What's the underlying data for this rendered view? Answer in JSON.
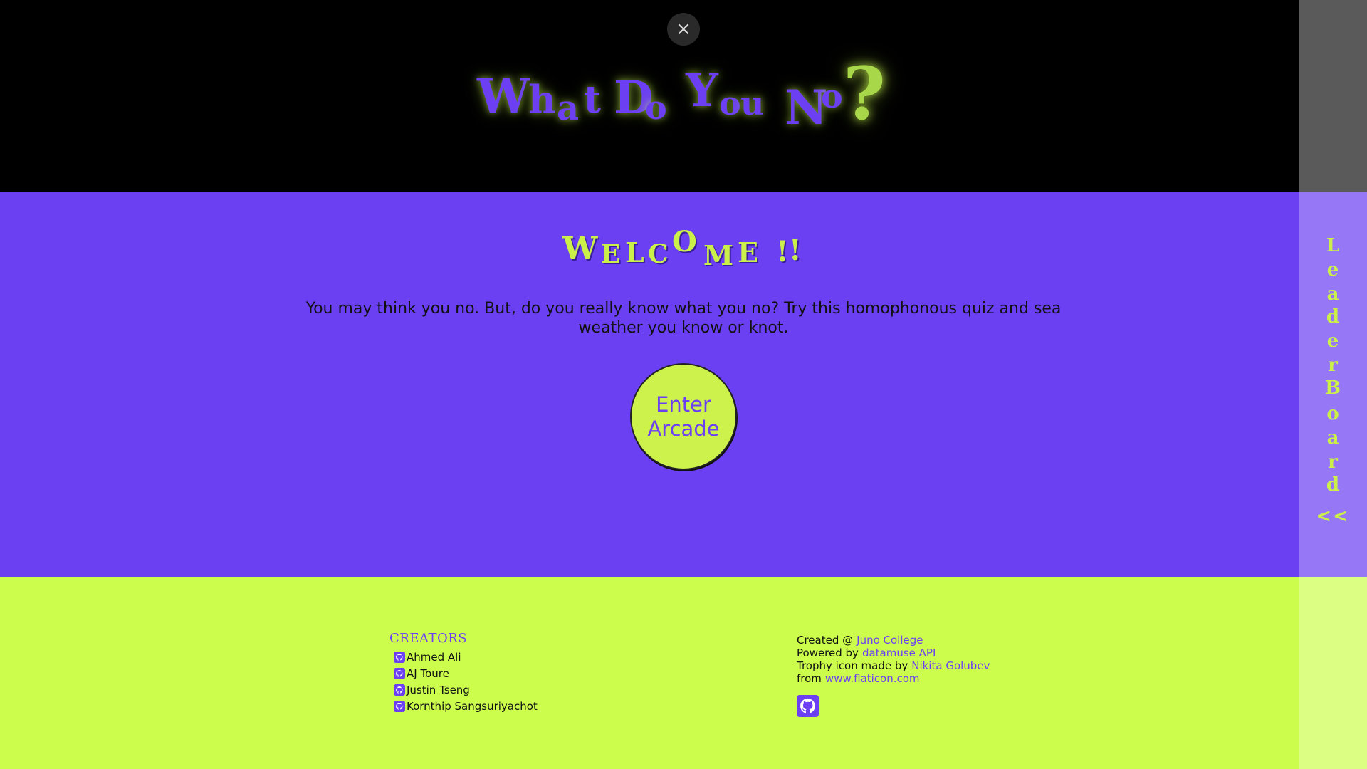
{
  "header": {
    "close_label": "×",
    "logo": {
      "letters": [
        "W",
        "h",
        "a",
        "t",
        "D",
        "o",
        "Y",
        "o",
        "u",
        "N",
        "o",
        "?"
      ]
    }
  },
  "main": {
    "welcome_letters": [
      "W",
      "E",
      "L",
      "C",
      "O",
      "M",
      "E",
      "!",
      "!"
    ],
    "intro": "You may think you no. But, do you really know what you no? Try this homophonous quiz and sea weather you know or knot.",
    "enter_button": "Enter\nArcade"
  },
  "footer": {
    "creators_title": "CREATORS",
    "creators": [
      "Ahmed Ali",
      "AJ Toure",
      "Justin Tseng",
      "Kornthip Sangsuriyachot"
    ],
    "credits": [
      {
        "text": "Created @",
        "link": "Juno College"
      },
      {
        "text": "Powered by",
        "link": "datamuse API"
      },
      {
        "text": "Trophy icon made by",
        "link": "Nikita Golubev"
      },
      {
        "text": "from",
        "link": "www.flaticon.com"
      }
    ],
    "repo_icon": "github-icon"
  },
  "sidebar": {
    "letters": [
      "L",
      "e",
      "a",
      "d",
      "e",
      "r",
      "B",
      "o",
      "a",
      "r",
      "d"
    ],
    "arrow": "<<"
  },
  "colors": {
    "purple": "#6b40f3",
    "lime": "#cdfd4c",
    "black": "#000000"
  }
}
